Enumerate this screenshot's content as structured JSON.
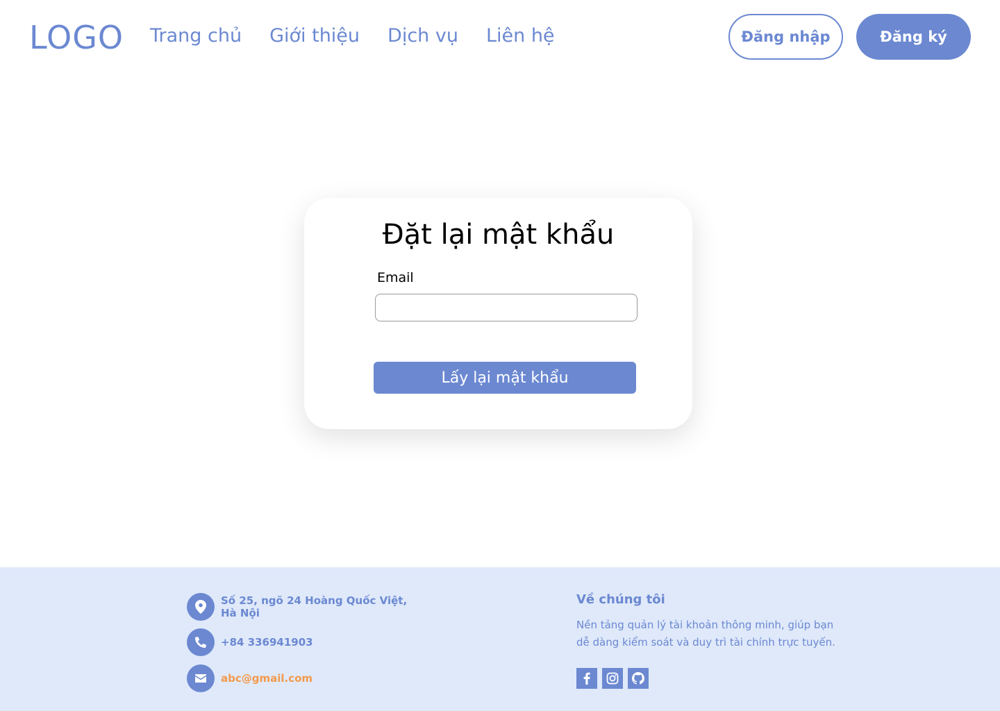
{
  "header": {
    "logo": "LOGO",
    "nav": [
      "Trang chủ",
      "Giới thiệu",
      "Dịch vụ",
      "Liên hệ"
    ],
    "login_label": "Đăng nhập",
    "register_label": "Đăng ký"
  },
  "card": {
    "title": "Đặt lại mật khẩu",
    "email_label": "Email",
    "email_value": "",
    "submit_label": "Lấy lại mật khẩu"
  },
  "footer": {
    "address_line1": "Số 25,  ngõ 24 Hoàng Quốc Việt,",
    "address_line2": "Hà Nội",
    "phone": "+84 336941903",
    "email": "abc@gmail.com",
    "about_title": "Về chúng tôi",
    "about_text": "Nền tảng quản lý tài khoản thông minh, giúp bạn dễ dàng kiểm soát và duy trì tài chính trực tuyến.",
    "social_icons": [
      "facebook-icon",
      "instagram-icon",
      "github-icon"
    ]
  },
  "colors": {
    "accent": "#6b88d1",
    "footer_bg": "#dfe9fa",
    "email_link": "#f39a4b"
  }
}
